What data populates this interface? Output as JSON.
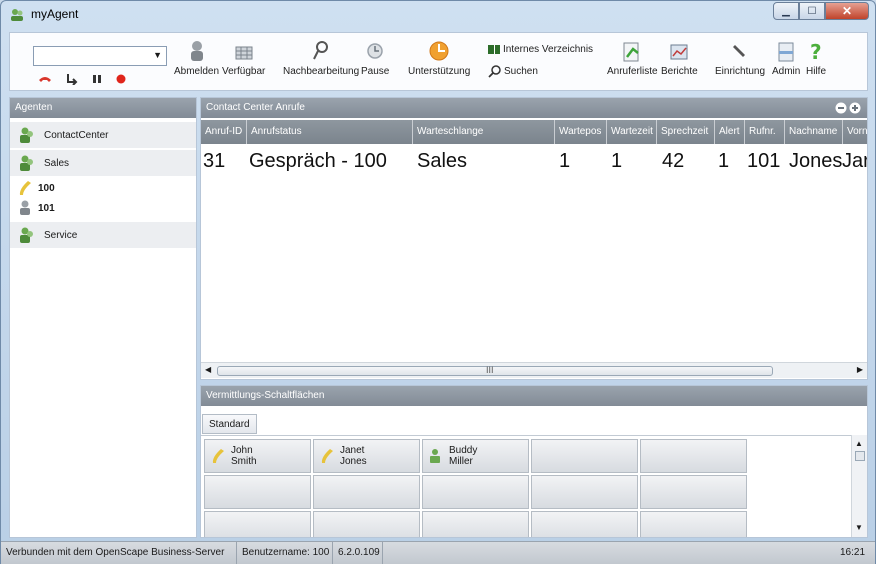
{
  "window": {
    "title": "myAgent"
  },
  "toolbar": {
    "logout_label": "Abmelden",
    "available_label": "Verfügbar",
    "wrapup_label": "Nachbearbeitung",
    "pause_label": "Pause",
    "support_label": "Unterstützung",
    "directory_label": "Internes Verzeichnis",
    "search_label": "Suchen",
    "caller_list_label": "Anruferliste",
    "reports_label": "Berichte",
    "setup_label": "Einrichtung",
    "admin_label": "Admin",
    "help_label": "Hilfe"
  },
  "agents_panel": {
    "title": "Agenten",
    "groups": [
      {
        "label": "ContactCenter"
      },
      {
        "label": "Sales"
      },
      {
        "label": "Service"
      }
    ],
    "agents": [
      {
        "label": "100"
      },
      {
        "label": "101"
      }
    ]
  },
  "calls_panel": {
    "title": "Contact Center Anrufe",
    "columns": [
      "Anruf-ID",
      "Anrufstatus",
      "Warteschlange",
      "Wartepos",
      "Wartezeit",
      "Sprechzeit",
      "Alert",
      "Rufnr.",
      "Nachname",
      "Vorn"
    ],
    "rows": [
      [
        "31",
        "Gespräch - 100",
        "Sales",
        "1",
        "1",
        "42",
        "1",
        "101",
        "Jones",
        "Jar"
      ]
    ],
    "scroll_mark": "III"
  },
  "speed_panel": {
    "title": "Vermittlungs-Schaltflächen",
    "tab": "Standard",
    "buttons": [
      {
        "line1": "John",
        "line2": "Smith"
      },
      {
        "line1": "Janet",
        "line2": "Jones"
      },
      {
        "line1": "Buddy",
        "line2": "Miller"
      }
    ]
  },
  "statusbar": {
    "connection": "Verbunden mit dem OpenScape Business-Server",
    "user": "Benutzername: 100",
    "version": "6.2.0.109",
    "time": "16:21"
  }
}
